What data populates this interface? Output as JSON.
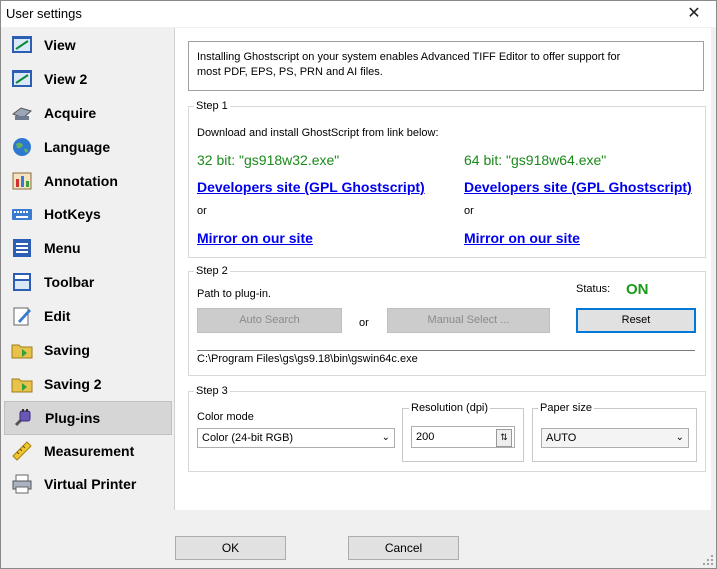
{
  "window": {
    "title": "User settings",
    "close_glyph": "✕"
  },
  "sidebar": {
    "items": [
      {
        "label": "View",
        "icon": "view-icon",
        "selected": false
      },
      {
        "label": "View 2",
        "icon": "view2-icon",
        "selected": false
      },
      {
        "label": "Acquire",
        "icon": "scanner-icon",
        "selected": false
      },
      {
        "label": "Language",
        "icon": "globe-icon",
        "selected": false
      },
      {
        "label": "Annotation",
        "icon": "annotation-icon",
        "selected": false
      },
      {
        "label": "HotKeys",
        "icon": "keyboard-icon",
        "selected": false
      },
      {
        "label": "Menu",
        "icon": "menu-icon",
        "selected": false
      },
      {
        "label": "Toolbar",
        "icon": "toolbar-icon",
        "selected": false
      },
      {
        "label": "Edit",
        "icon": "edit-icon",
        "selected": false
      },
      {
        "label": "Saving",
        "icon": "folder-save-icon",
        "selected": false
      },
      {
        "label": "Saving 2",
        "icon": "folder-save2-icon",
        "selected": false
      },
      {
        "label": "Plug-ins",
        "icon": "plugin-icon",
        "selected": true
      },
      {
        "label": "Measurement",
        "icon": "ruler-icon",
        "selected": false
      },
      {
        "label": "Virtual Printer",
        "icon": "printer-icon",
        "selected": false
      }
    ]
  },
  "info_text": "Installing Ghostscript on your system enables Advanced TIFF Editor to offer support for most PDF, EPS, PS, PRN and AI files.",
  "step1": {
    "title": "Step 1",
    "instruction": "Download and install GhostScript from link below:",
    "col32": {
      "label": "32 bit: \"gs918w32.exe\"",
      "dev_link": "Developers site (GPL Ghostscript)",
      "or": "or",
      "mirror_link": "Mirror on our site"
    },
    "col64": {
      "label": "64 bit: \"gs918w64.exe\"",
      "dev_link": "Developers site (GPL Ghostscript)",
      "or": "or",
      "mirror_link": "Mirror on our site"
    }
  },
  "step2": {
    "title": "Step 2",
    "path_label": "Path to plug-in.",
    "status_label": "Status:",
    "status_value": "ON",
    "auto_search": "Auto Search",
    "or": "or",
    "manual_select": "Manual Select ...",
    "reset": "Reset",
    "path_value": "C:\\Program Files\\gs\\gs9.18\\bin\\gswin64c.exe"
  },
  "step3": {
    "title": "Step 3",
    "color_mode_label": "Color mode",
    "color_mode_value": "Color (24-bit RGB)",
    "resolution_label": "Resolution (dpi)",
    "resolution_value": "200",
    "paper_label": "Paper size",
    "paper_value": "AUTO"
  },
  "footer": {
    "ok": "OK",
    "cancel": "Cancel"
  },
  "colors": {
    "status_on": "#1a9a1a",
    "link": "#0000ee",
    "green_text": "#1a8a1a",
    "focus_border": "#0078d7"
  }
}
